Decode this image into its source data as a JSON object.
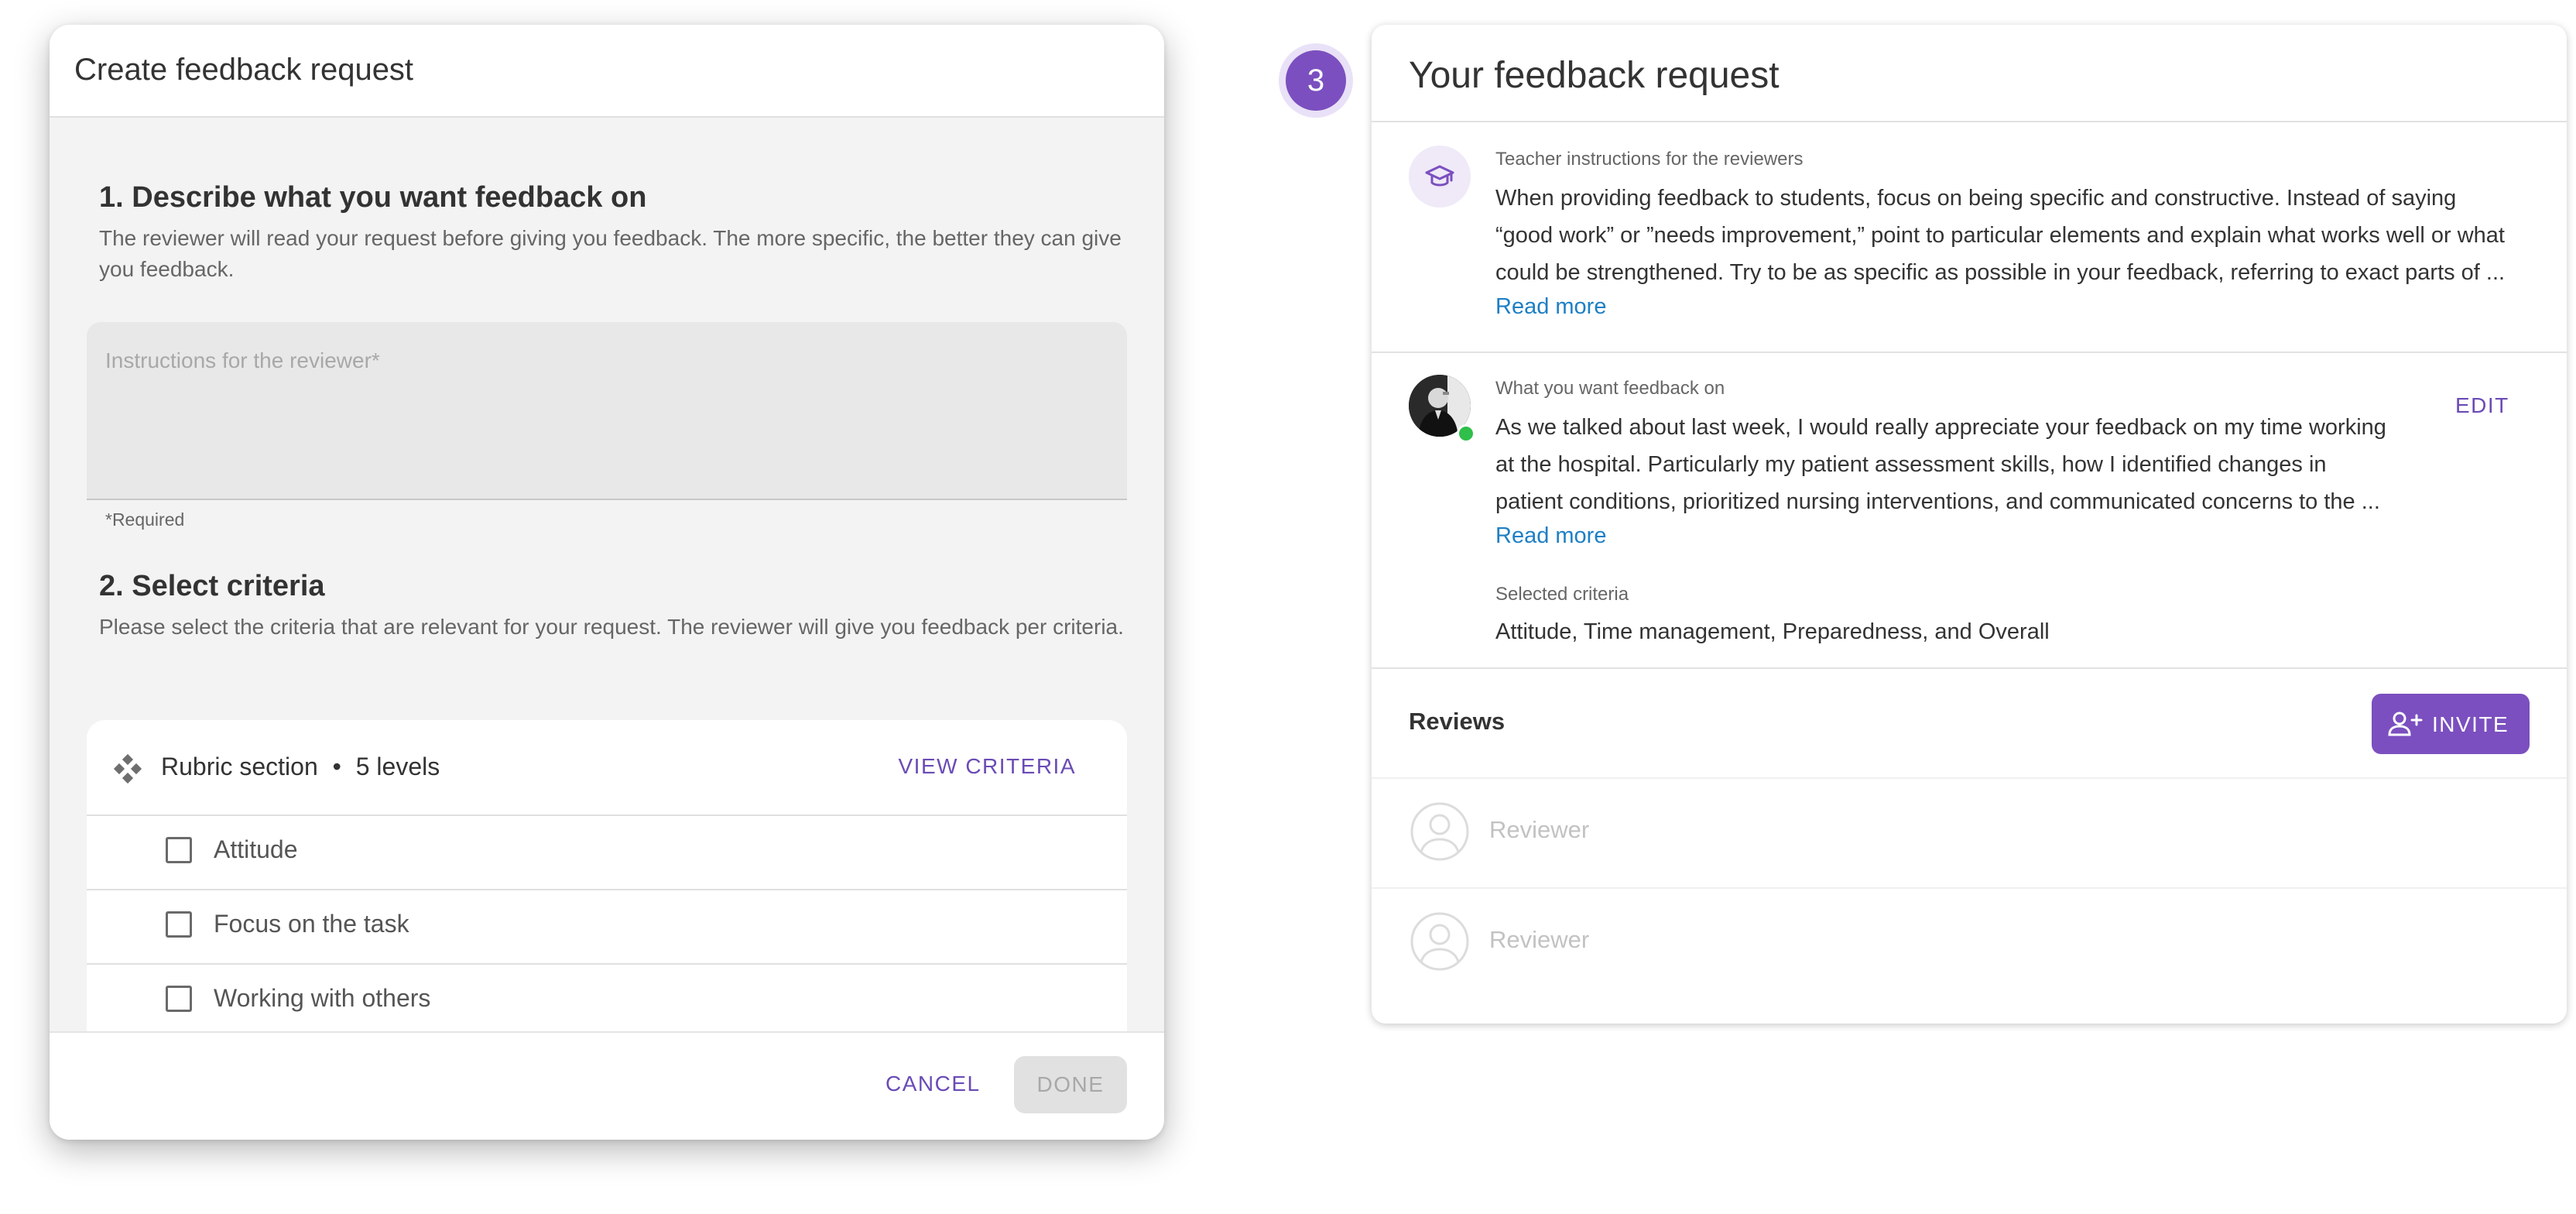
{
  "dialog": {
    "title": "Create feedback request",
    "section1": {
      "title": "1. Describe what you want feedback on",
      "description": "The reviewer will read your request before giving you feedback. The more specific, the better they can give you feedback.",
      "input_placeholder": "Instructions for the reviewer*",
      "required_note": "*Required"
    },
    "section2": {
      "title": "2. Select criteria",
      "description": "Please select the criteria that are relevant for your request. The reviewer will give you feedback per criteria."
    },
    "rubric": {
      "name": "Rubric section",
      "separator": "•",
      "levels": "5 levels",
      "view_criteria": "VIEW CRITERIA",
      "criteria": [
        {
          "label": "Attitude",
          "checked": false
        },
        {
          "label": "Focus on the task",
          "checked": false
        },
        {
          "label": "Working with others",
          "checked": false
        }
      ]
    },
    "footer": {
      "cancel": "CANCEL",
      "done": "DONE"
    }
  },
  "step": {
    "number": "3"
  },
  "request": {
    "title": "Your feedback request",
    "teacher": {
      "label": "Teacher instructions for the reviewers",
      "lines": [
        "When providing feedback to students, focus on being specific and constructive. Instead of saying",
        "“good work” or ”needs improvement,” point to particular elements and explain what works well or what",
        "could be strengthened. Try to be as specific as possible in your feedback, referring to exact parts of ..."
      ],
      "read_more": "Read more"
    },
    "student": {
      "label": "What you want feedback on",
      "lines": [
        "As we talked about last week, I would really appreciate your feedback on my time working",
        "at the hospital. Particularly my patient assessment skills,  how I identified changes in",
        "patient conditions, prioritized nursing interventions, and communicated concerns to the ..."
      ],
      "read_more": "Read more",
      "edit": "EDIT",
      "criteria_label": "Selected criteria",
      "criteria_value": "Attitude, Time management, Preparedness, and Overall"
    },
    "reviews": {
      "title": "Reviews",
      "invite": "INVITE",
      "reviewers": [
        {
          "name": "Reviewer"
        },
        {
          "name": "Reviewer"
        }
      ]
    }
  },
  "colors": {
    "accent": "#7b4fbf",
    "link": "#1d7fc4",
    "online": "#2fbf4a"
  }
}
